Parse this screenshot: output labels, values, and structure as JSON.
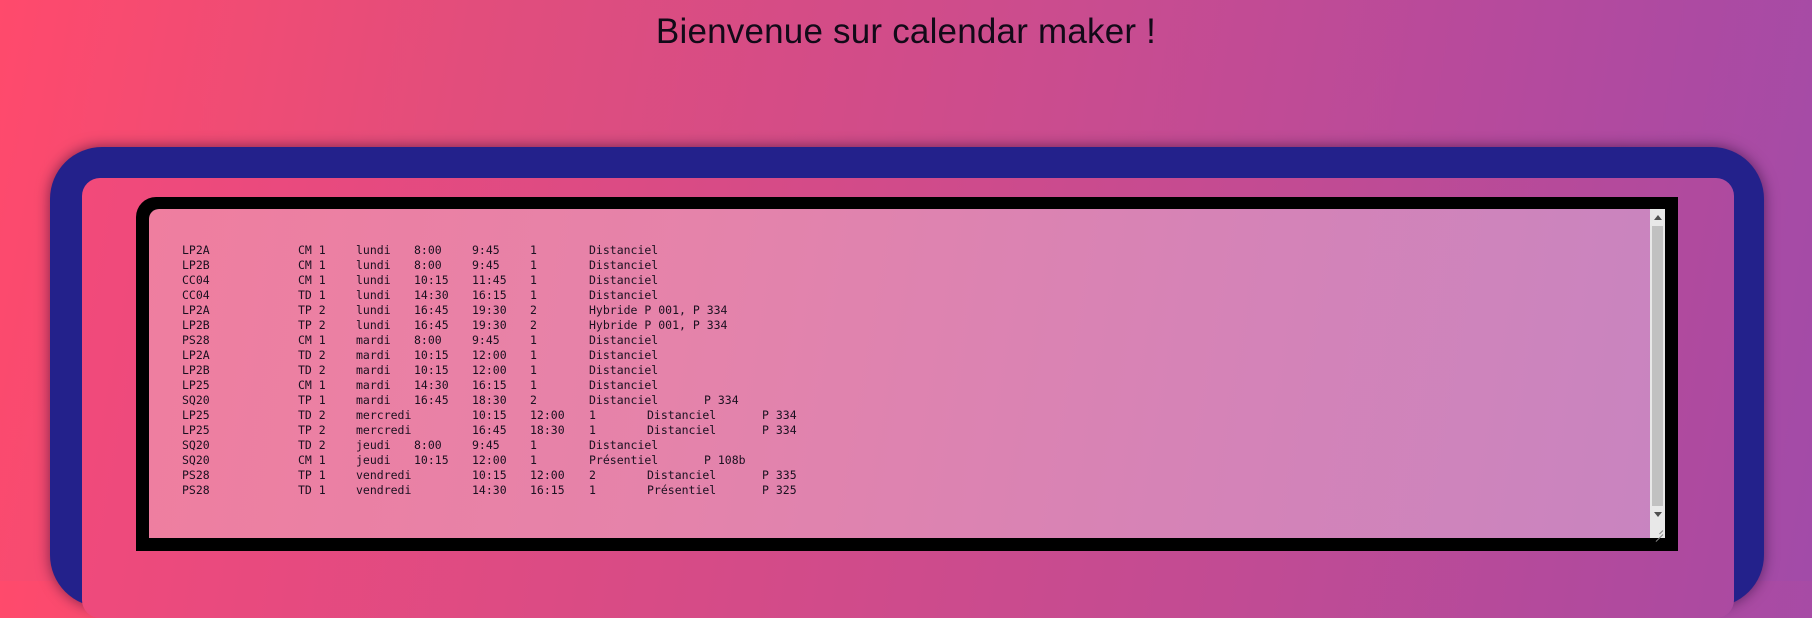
{
  "header": {
    "title": "Bienvenue sur calendar maker !"
  },
  "schedule": {
    "rows": [
      {
        "group": "LP2A",
        "type": "CM 1",
        "day": "lundi",
        "start": "8:00",
        "end": "9:45",
        "count": "1",
        "mode": "Distanciel",
        "room": ""
      },
      {
        "group": "LP2B",
        "type": "CM 1",
        "day": "lundi",
        "start": "8:00",
        "end": "9:45",
        "count": "1",
        "mode": "Distanciel",
        "room": ""
      },
      {
        "group": "CC04",
        "type": "CM 1",
        "day": "lundi",
        "start": "10:15",
        "end": "11:45",
        "count": "1",
        "mode": "Distanciel",
        "room": ""
      },
      {
        "group": "CC04",
        "type": "TD 1",
        "day": "lundi",
        "start": "14:30",
        "end": "16:15",
        "count": "1",
        "mode": "Distanciel",
        "room": ""
      },
      {
        "group": "LP2A",
        "type": "TP 2",
        "day": "lundi",
        "start": "16:45",
        "end": "19:30",
        "count": "2",
        "mode": "Hybride P 001, P 334",
        "room": ""
      },
      {
        "group": "LP2B",
        "type": "TP 2",
        "day": "lundi",
        "start": "16:45",
        "end": "19:30",
        "count": "2",
        "mode": "Hybride P 001, P 334",
        "room": ""
      },
      {
        "group": "PS28",
        "type": "CM 1",
        "day": "mardi",
        "start": "8:00",
        "end": "9:45",
        "count": "1",
        "mode": "Distanciel",
        "room": ""
      },
      {
        "group": "LP2A",
        "type": "TD 2",
        "day": "mardi",
        "start": "10:15",
        "end": "12:00",
        "count": "1",
        "mode": "Distanciel",
        "room": ""
      },
      {
        "group": "LP2B",
        "type": "TD 2",
        "day": "mardi",
        "start": "10:15",
        "end": "12:00",
        "count": "1",
        "mode": "Distanciel",
        "room": ""
      },
      {
        "group": "LP25",
        "type": "CM 1",
        "day": "mardi",
        "start": "14:30",
        "end": "16:15",
        "count": "1",
        "mode": "Distanciel",
        "room": ""
      },
      {
        "group": "SQ20",
        "type": "TP 1",
        "day": "mardi",
        "start": "16:45",
        "end": "18:30",
        "count": "2",
        "mode": "Distanciel",
        "room": "P 334"
      },
      {
        "group": "LP25",
        "type": "TD 2",
        "day": "mercredi",
        "start": "10:15",
        "end": "12:00",
        "count": "1",
        "mode": "Distanciel",
        "room": "P 334"
      },
      {
        "group": "LP25",
        "type": "TP 2",
        "day": "mercredi",
        "start": "16:45",
        "end": "18:30",
        "count": "1",
        "mode": "Distanciel",
        "room": "P 334"
      },
      {
        "group": "SQ20",
        "type": "TD 2",
        "day": "jeudi",
        "start": "8:00",
        "end": "9:45",
        "count": "1",
        "mode": "Distanciel",
        "room": ""
      },
      {
        "group": "SQ20",
        "type": "CM 1",
        "day": "jeudi",
        "start": "10:15",
        "end": "12:00",
        "count": "1",
        "mode": "Présentiel",
        "room": "P 108b"
      },
      {
        "group": "PS28",
        "type": "TP 1",
        "day": "vendredi",
        "start": "10:15",
        "end": "12:00",
        "count": "2",
        "mode": "Distanciel",
        "room": "P 335"
      },
      {
        "group": "PS28",
        "type": "TD 1",
        "day": "vendredi",
        "start": "14:30",
        "end": "16:15",
        "count": "1",
        "mode": "Présentiel",
        "room": "P 325"
      }
    ]
  }
}
